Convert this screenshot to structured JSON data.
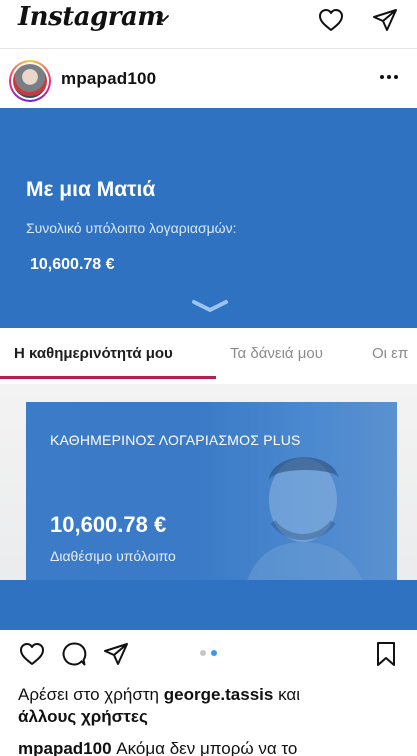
{
  "app": {
    "logo_text": "Instagram"
  },
  "icons": {
    "chevron": "chevron-down-icon",
    "heart": "heart-icon",
    "send": "send-icon",
    "comment": "comment-icon",
    "bookmark": "bookmark-icon",
    "more": "more-icon"
  },
  "post": {
    "username": "mpapad100",
    "carousel": {
      "current": 2,
      "total": 2
    },
    "likes": {
      "prefix": "Αρέσει στο χρήστη ",
      "user": "george.tassis",
      "mid": " και",
      "others": "άλλους χρήστες"
    },
    "caption": {
      "user": "mpapad100",
      "text": " Ακόμα δεν μπορώ να το"
    }
  },
  "screenshot": {
    "hero_title": "Με μια Ματιά",
    "hero_subtitle": "Συνολικό υπόλοιπο λογαριασμών:",
    "hero_amount": "10,600.78 €",
    "tabs": [
      "Η καθημερινότητά μου",
      "Τα δάνειά μου",
      "Οι επ"
    ],
    "card_title": "ΚΑΘΗΜΕΡΙΝΟΣ ΛΟΓΑΡΙΑΣΜΟΣ PLUS",
    "card_amount": "10,600.78 €",
    "card_subtitle": "Διαθέσιμο υπόλοιπο"
  },
  "colors": {
    "bank_blue": "#2f72c2",
    "tab_accent": "#b0224b",
    "dot_active": "#3897f0"
  }
}
